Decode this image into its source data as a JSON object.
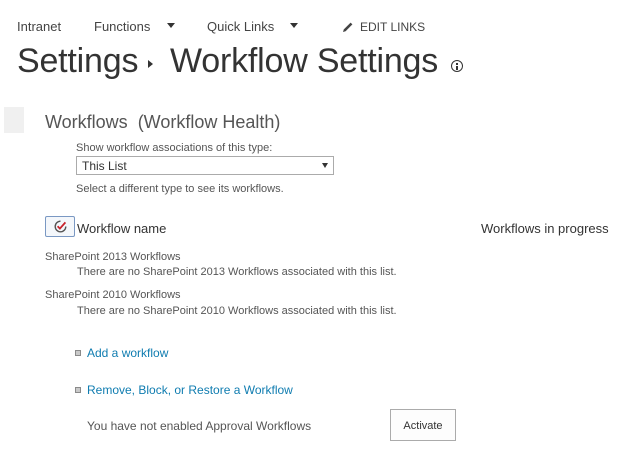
{
  "top_nav": {
    "items": [
      {
        "label": "Intranet"
      },
      {
        "label": "Functions"
      },
      {
        "label": "Quick Links"
      }
    ],
    "edit_links_label": "EDIT LINKS"
  },
  "title": {
    "breadcrumb_root": "Settings",
    "current_page": "Workflow Settings"
  },
  "section": {
    "heading": "Workflows",
    "subheading": "(Workflow Health)",
    "associations_label": "Show workflow associations of this type:",
    "associations_value": "This List",
    "associations_hint": "Select a different type to see its workflows."
  },
  "table": {
    "col_name": "Workflow name",
    "col_progress": "Workflows in progress"
  },
  "groups": [
    {
      "title": "SharePoint 2013 Workflows",
      "message": "There are no SharePoint 2013 Workflows associated with this list."
    },
    {
      "title": "SharePoint 2010 Workflows",
      "message": "There are no SharePoint 2010 Workflows associated with this list."
    }
  ],
  "links": {
    "add_workflow": "Add a workflow",
    "remove_block_restore": "Remove, Block, or Restore a Workflow"
  },
  "approval": {
    "message": "You have not enabled Approval Workflows",
    "activate_label": "Activate"
  },
  "colors": {
    "link": "#0f7cb0",
    "text": "#444444",
    "check_accent": "#c8232c"
  },
  "icons": [
    "caret-down-icon",
    "pencil-icon",
    "breadcrumb-arrow-icon",
    "info-icon",
    "check-circle-icon",
    "bullet-icon"
  ]
}
